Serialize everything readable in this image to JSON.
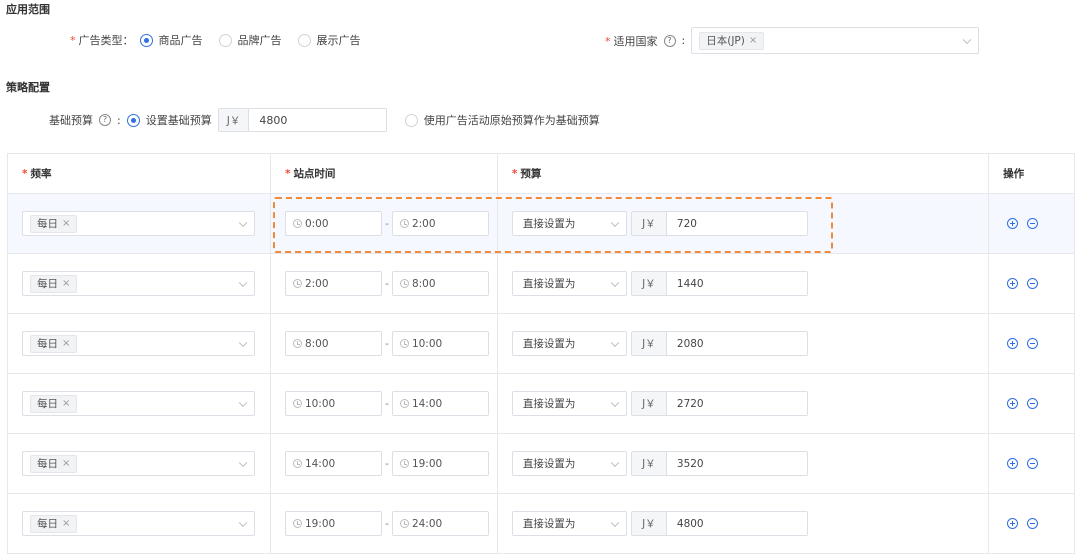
{
  "scope": {
    "title": "应用范围",
    "ad_type_label": "广告类型：",
    "ad_types": [
      {
        "label": "商品广告",
        "selected": true
      },
      {
        "label": "品牌广告",
        "selected": false
      },
      {
        "label": "展示广告",
        "selected": false
      }
    ],
    "country_label": "适用国家",
    "country_tag": "日本(JP)"
  },
  "strategy": {
    "title": "策略配置",
    "base_budget_label": "基础预算",
    "option_set": "设置基础预算",
    "currency": "J￥",
    "base_value": "4800",
    "option_original": "使用广告活动原始预算作为基础预算",
    "set_selected": true
  },
  "table": {
    "headers": {
      "freq": "频率",
      "time": "站点时间",
      "budget": "预算",
      "ops": "操作"
    },
    "rows": [
      {
        "freq": "每日",
        "start": "0:00",
        "end": "2:00",
        "mode": "直接设置为",
        "currency": "J￥",
        "amount": "720"
      },
      {
        "freq": "每日",
        "start": "2:00",
        "end": "8:00",
        "mode": "直接设置为",
        "currency": "J￥",
        "amount": "1440"
      },
      {
        "freq": "每日",
        "start": "8:00",
        "end": "10:00",
        "mode": "直接设置为",
        "currency": "J￥",
        "amount": "2080"
      },
      {
        "freq": "每日",
        "start": "10:00",
        "end": "14:00",
        "mode": "直接设置为",
        "currency": "J￥",
        "amount": "2720"
      },
      {
        "freq": "每日",
        "start": "14:00",
        "end": "19:00",
        "mode": "直接设置为",
        "currency": "J￥",
        "amount": "3520"
      },
      {
        "freq": "每日",
        "start": "19:00",
        "end": "24:00",
        "mode": "直接设置为",
        "currency": "J￥",
        "amount": "4800"
      }
    ]
  },
  "colors": {
    "accent": "#2f6fe4",
    "required": "#f04a3a",
    "highlight": "#f28a3a"
  }
}
